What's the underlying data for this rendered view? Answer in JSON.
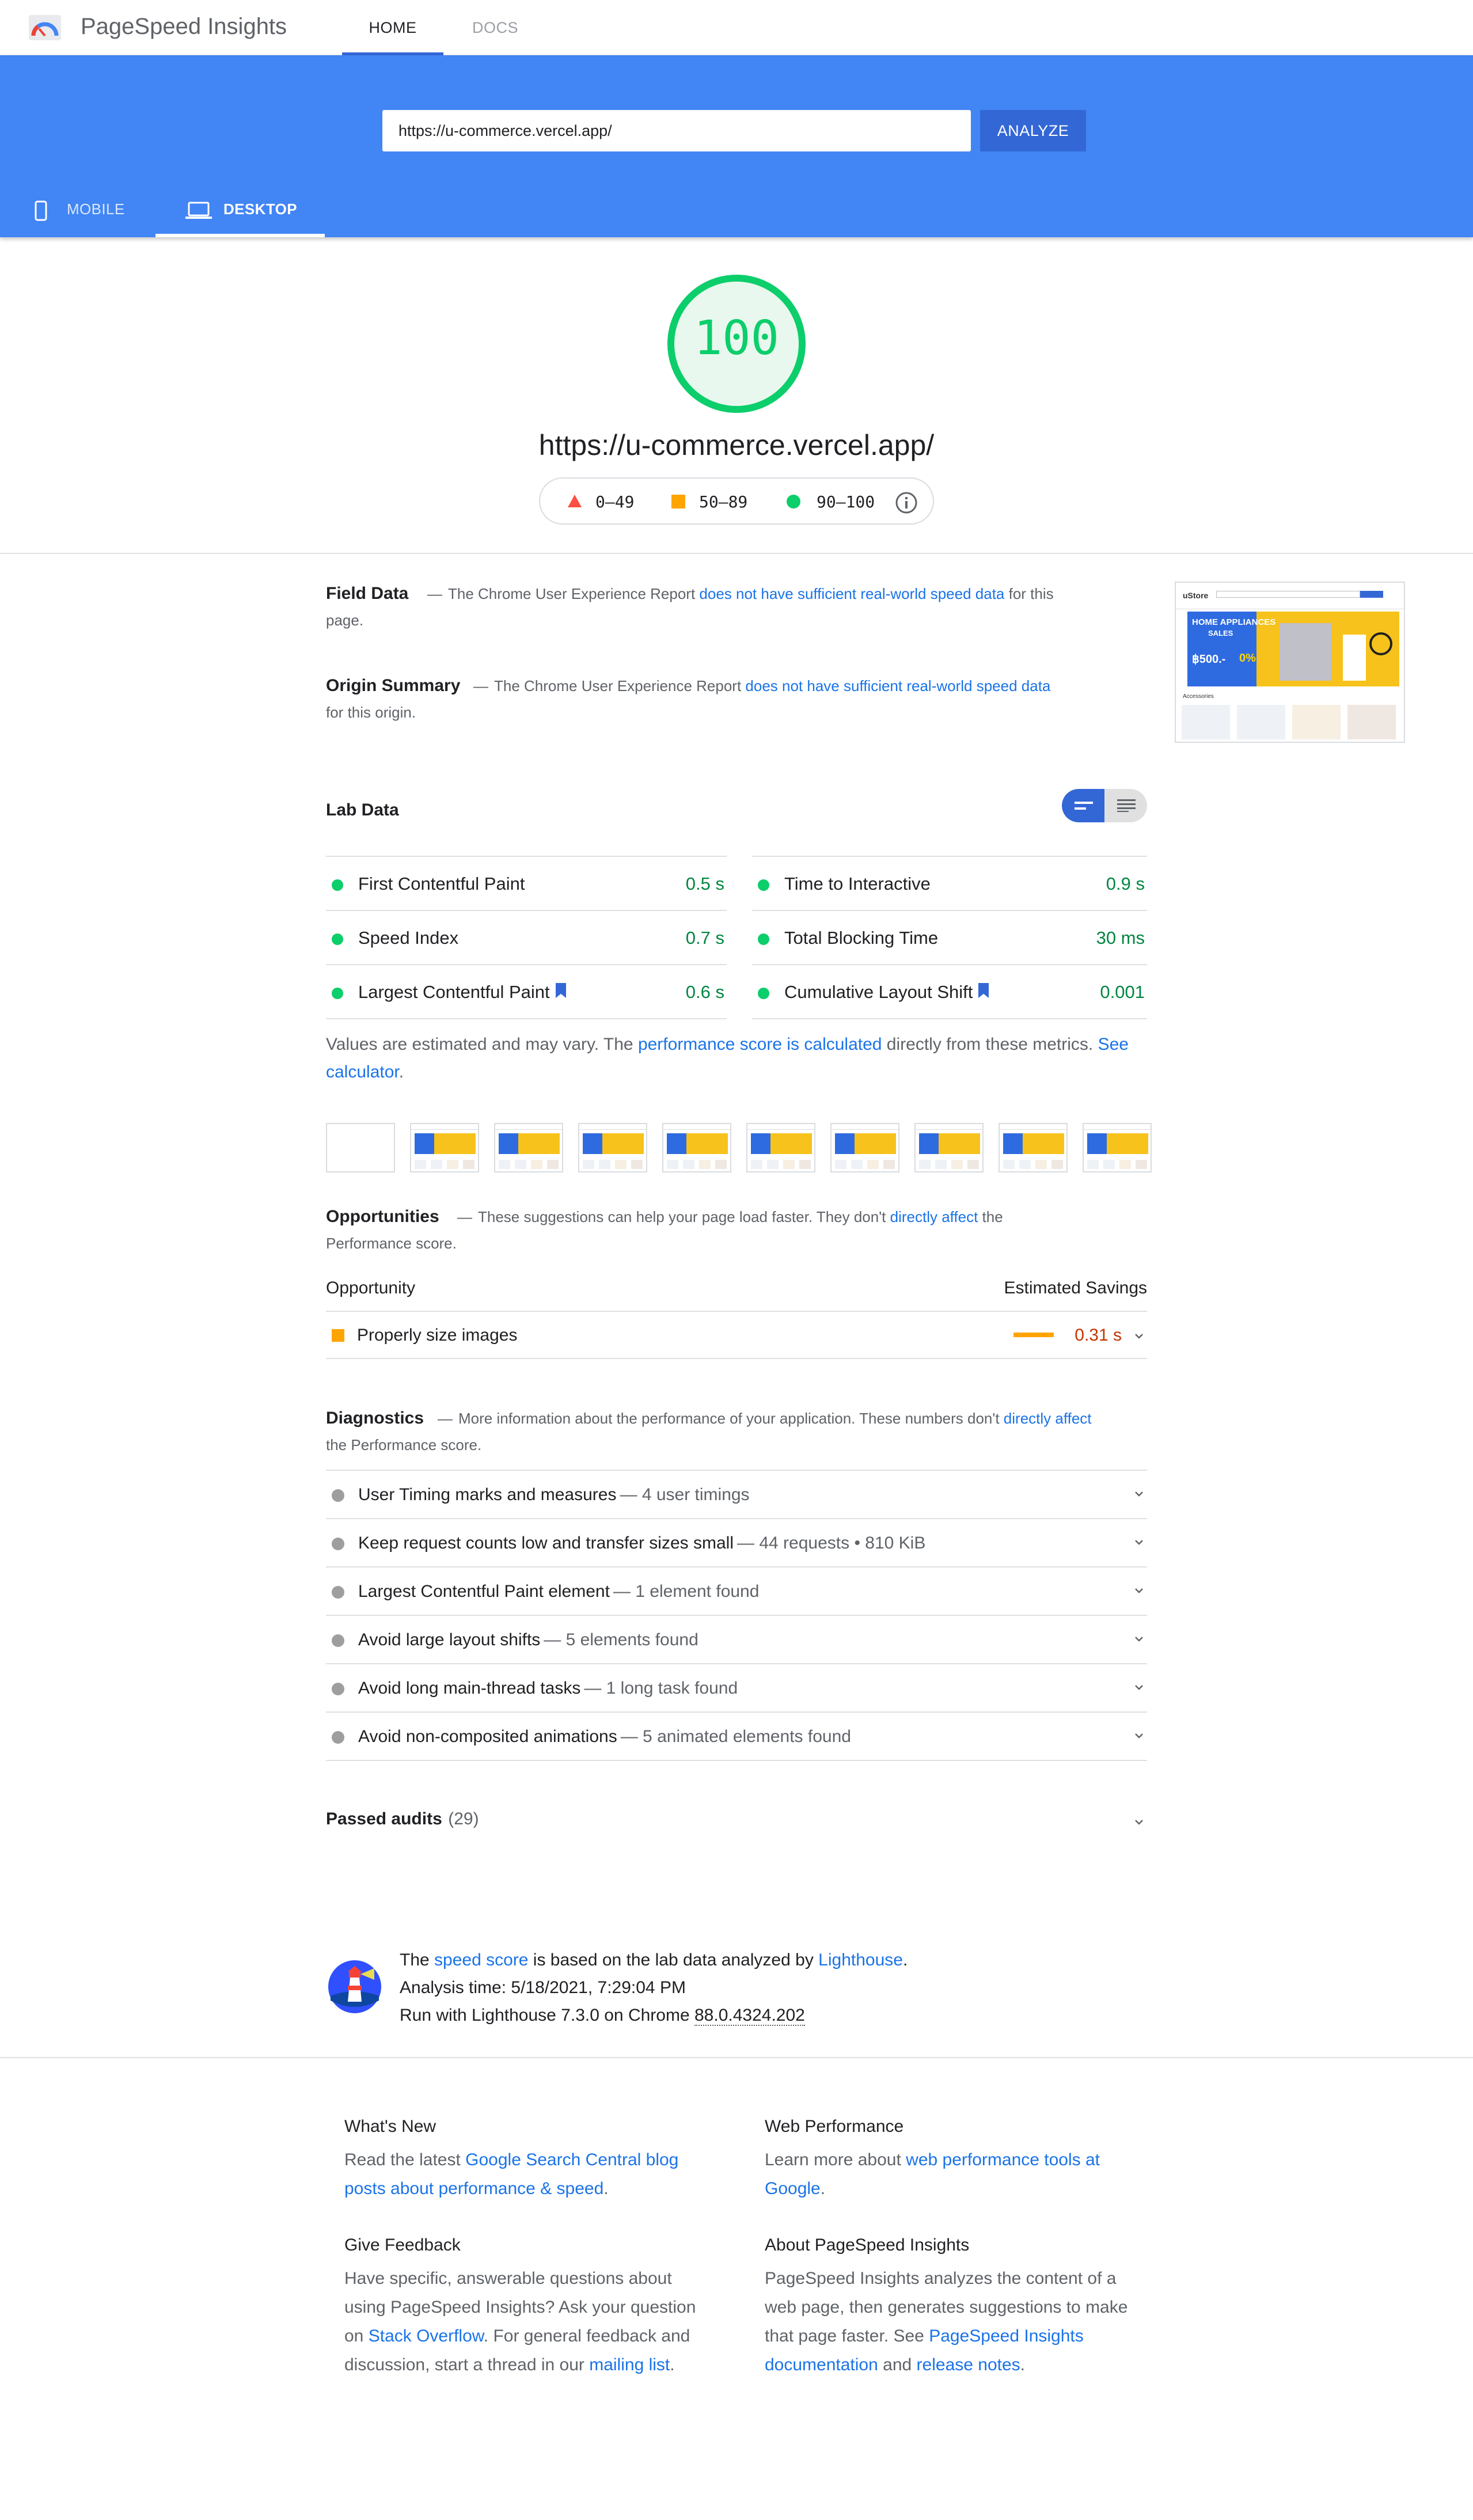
{
  "app": {
    "brand": "PageSpeed Insights",
    "nav": {
      "home": "HOME",
      "docs": "DOCS"
    }
  },
  "search": {
    "url": "https://u-commerce.vercel.app/",
    "analyze_label": "ANALYZE"
  },
  "device_tabs": {
    "mobile": "MOBILE",
    "desktop": "DESKTOP",
    "selected": "desktop"
  },
  "score": {
    "value": "100",
    "url": "https://u-commerce.vercel.app/",
    "legend": {
      "red": "0–49",
      "orange": "50–89",
      "green": "90–100"
    },
    "colors": {
      "pass": "#0cce6b",
      "average": "#ffa400",
      "fail": "#ff4e42"
    }
  },
  "field_data": {
    "title": "Field Data",
    "pre": "The Chrome User Experience Report ",
    "link": "does not have sufficient real-world speed data",
    "post": " for this page."
  },
  "origin_summary": {
    "title": "Origin Summary",
    "pre": "The Chrome User Experience Report ",
    "link": "does not have sufficient real-world speed data",
    "post": " for this origin."
  },
  "preview": {
    "store_name": "uStore",
    "banner_line1": "HOME APPLIANCES",
    "banner_line2": "SALES",
    "banner_price": "฿500.-",
    "banner_discount": "0%",
    "section_label": "Accessories"
  },
  "lab_data": {
    "title": "Lab Data",
    "metrics": [
      {
        "name": "First Contentful Paint",
        "value": "0.5 s",
        "flag": false
      },
      {
        "name": "Time to Interactive",
        "value": "0.9 s",
        "flag": false
      },
      {
        "name": "Speed Index",
        "value": "0.7 s",
        "flag": false
      },
      {
        "name": "Total Blocking Time",
        "value": "30 ms",
        "flag": false
      },
      {
        "name": "Largest Contentful Paint",
        "value": "0.6 s",
        "flag": true
      },
      {
        "name": "Cumulative Layout Shift",
        "value": "0.001",
        "flag": true
      }
    ],
    "note_pre": "Values are estimated and may vary. The ",
    "note_link": "performance score is calculated",
    "note_mid": " directly from these metrics. ",
    "note_link2": "See calculator",
    "note_post": "."
  },
  "opportunities": {
    "title": "Opportunities",
    "pre": "These suggestions can help your page load faster. They don't ",
    "link": "directly affect",
    "post": " the Performance score.",
    "col_left": "Opportunity",
    "col_right": "Estimated Savings",
    "items": [
      {
        "name": "Properly size images",
        "savings": "0.31 s"
      }
    ]
  },
  "diagnostics": {
    "title": "Diagnostics",
    "pre": "More information about the performance of your application. These numbers don't ",
    "link": "directly affect",
    "post": " the Performance score.",
    "items": [
      {
        "name": "User Timing marks and measures",
        "detail": "— 4 user timings"
      },
      {
        "name": "Keep request counts low and transfer sizes small",
        "detail": "— 44 requests • 810 KiB"
      },
      {
        "name": "Largest Contentful Paint element",
        "detail": "— 1 element found"
      },
      {
        "name": "Avoid large layout shifts",
        "detail": "— 5 elements found"
      },
      {
        "name": "Avoid long main-thread tasks",
        "detail": "— 1 long task found"
      },
      {
        "name": "Avoid non-composited animations",
        "detail": "— 5 animated elements found"
      }
    ]
  },
  "passed": {
    "label": "Passed audits",
    "count": "(29)"
  },
  "lighthouse": {
    "pre": "The ",
    "link1": "speed score",
    "mid": " is based on the lab data analyzed by ",
    "link2": "Lighthouse",
    "post": ".",
    "analysis_time": "Analysis time: 5/18/2021, 7:29:04 PM",
    "run_pre": "Run with Lighthouse 7.3.0 on Chrome ",
    "chrome_version": "88.0.4324.202"
  },
  "footer": {
    "whats_new": {
      "title": "What's New",
      "pre": "Read the latest ",
      "link": "Google Search Central blog posts about performance & speed",
      "post": "."
    },
    "web_perf": {
      "title": "Web Performance",
      "pre": "Learn more about ",
      "link": "web performance tools at Google",
      "post": "."
    },
    "feedback": {
      "title": "Give Feedback",
      "pre": "Have specific, answerable questions about using PageSpeed Insights? Ask your question on ",
      "link1": "Stack Overflow",
      "mid": ". For general feedback and discussion, start a thread in our ",
      "link2": "mailing list",
      "post": "."
    },
    "about": {
      "title": "About PageSpeed Insights",
      "pre": "PageSpeed Insights analyzes the content of a web page, then generates suggestions to make that page faster. See ",
      "link1": "PageSpeed Insights documentation",
      "mid": " and ",
      "link2": "release notes",
      "post": "."
    }
  }
}
